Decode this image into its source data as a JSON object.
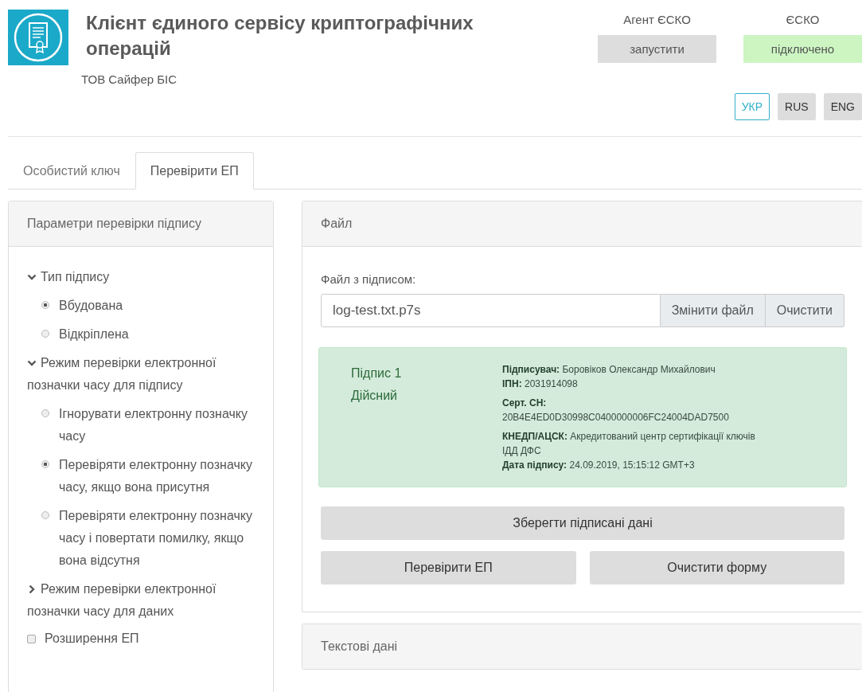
{
  "header": {
    "title": "Клієнт єдиного сервісу криптографічних операцій",
    "company": "ТОВ Сайфер БІС",
    "services": [
      {
        "label": "Агент ЄСКО",
        "status": "запустити",
        "kind": "action"
      },
      {
        "label": "ЄСКО",
        "status": "підключено",
        "kind": "ok"
      }
    ],
    "languages": [
      {
        "label": "УКР",
        "selected": true
      },
      {
        "label": "RUS",
        "selected": false
      },
      {
        "label": "ENG",
        "selected": false
      }
    ]
  },
  "tabs": [
    {
      "label": "Особистий ключ",
      "selected": false
    },
    {
      "label": "Перевірити ЕП",
      "selected": true
    }
  ],
  "sidebar": {
    "title": "Параметри перевірки підпису",
    "items": [
      {
        "kind": "section",
        "label": "Тип підпису",
        "expanded": true,
        "children": [
          {
            "label": "Вбудована",
            "selected": true
          },
          {
            "label": "Відкріплена",
            "selected": false
          }
        ]
      },
      {
        "kind": "section",
        "label": "Режим перевірки електронної позначки часу для підпису",
        "expanded": true,
        "children": [
          {
            "label": "Ігнорувати електронну позначку часу",
            "selected": false
          },
          {
            "label": "Перевіряти електронну позначку часу, якщо вона присутня",
            "selected": true
          },
          {
            "label": "Перевіряти електронну позначку часу і повертати помилку, якщо вона відсутня",
            "selected": false
          }
        ]
      },
      {
        "kind": "section",
        "label": "Режим перевірки електронної позначки часу для даних",
        "expanded": false
      },
      {
        "kind": "checkbox",
        "label": "Розширення ЕП",
        "checked": false
      }
    ]
  },
  "file_panel": {
    "title": "Файл",
    "field_label": "Файл з підписом:",
    "value": "log-test.txt.p7s",
    "field_buttons": [
      "Змінити файл",
      "Очистити"
    ],
    "signature": {
      "name": "Підпис 1",
      "status": "Дійсний",
      "details": [
        [
          "**Підписувач:** Боровіков Олександр Михайлович",
          "**ІПН:** 2031914098"
        ],
        [
          "**Серт. СН:**",
          "20B4E4ED0D30998C0400000006FC24004DAD7500"
        ],
        [
          "**КНЕДП/АЦСК:** Акредитований центр сертифікації ключів ІДД ДФС",
          "**Дата підпису:** 24.09.2019, 15:15:12 GMT+3"
        ]
      ]
    },
    "save_button": "Зберегти підписані дані",
    "buttons": [
      "Перевірити ЕП",
      "Очистити форму"
    ]
  },
  "text_panel": {
    "title": "Текстові дані"
  }
}
